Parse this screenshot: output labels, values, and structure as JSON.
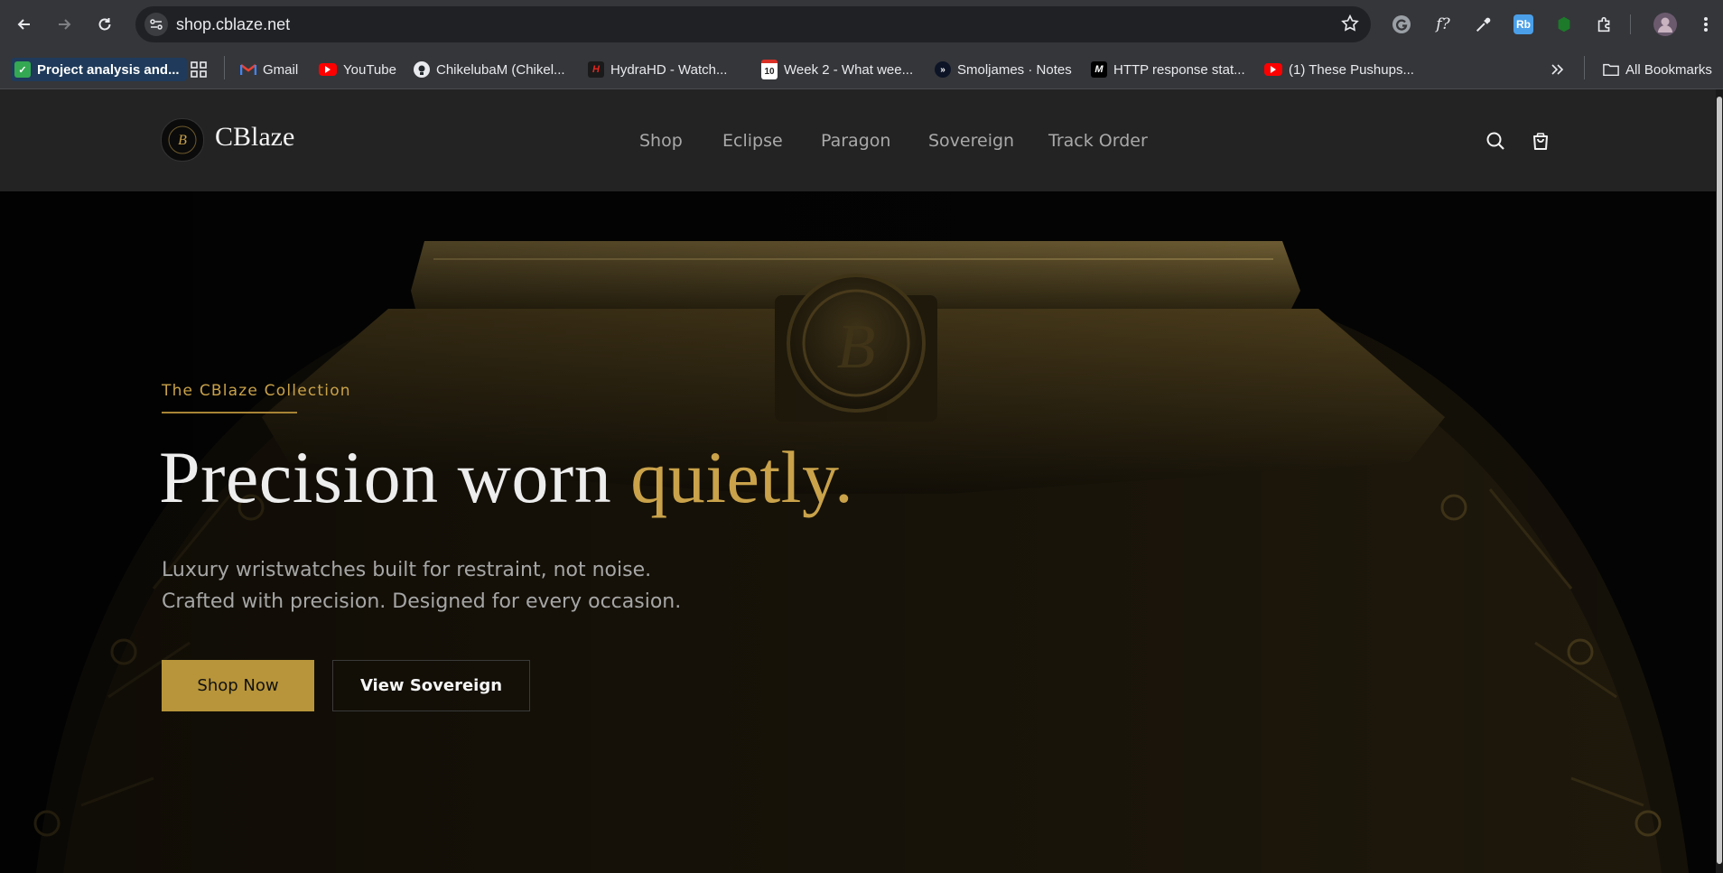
{
  "browser": {
    "url": "shop.cblaze.net",
    "bookmarks": [
      {
        "label": "Project analysis and..."
      },
      {
        "label": "Gmail"
      },
      {
        "label": "YouTube"
      },
      {
        "label": "ChikelubaM (Chikel..."
      },
      {
        "label": "HydraHD - Watch..."
      },
      {
        "label": "Week 2 - What wee..."
      },
      {
        "label": "Smoljames · Notes"
      },
      {
        "label": "HTTP response stat..."
      },
      {
        "label": "(1) These Pushups..."
      }
    ],
    "all_bookmarks": "All Bookmarks",
    "calendar_badge": "10",
    "ext_rb": "Rb",
    "ext_f": "f?"
  },
  "site": {
    "logo_text": "CBlaze",
    "nav": [
      "Shop",
      "Eclipse",
      "Paragon",
      "Sovereign",
      "Track Order"
    ]
  },
  "hero": {
    "eyebrow": "The CBlaze Collection",
    "headline_main": "Precision worn ",
    "headline_accent": "quietly.",
    "sub_line1": "Luxury wristwatches built for restraint, not noise.",
    "sub_line2": "Crafted with precision. Designed for every occasion.",
    "primary_cta": "Shop Now",
    "secondary_cta": "View Sovereign",
    "crown_monogram": "B"
  },
  "colors": {
    "gold": "#c9a24a",
    "button_gold": "#b8953a",
    "header_bg": "#232323",
    "chrome_bg": "#35363a"
  }
}
